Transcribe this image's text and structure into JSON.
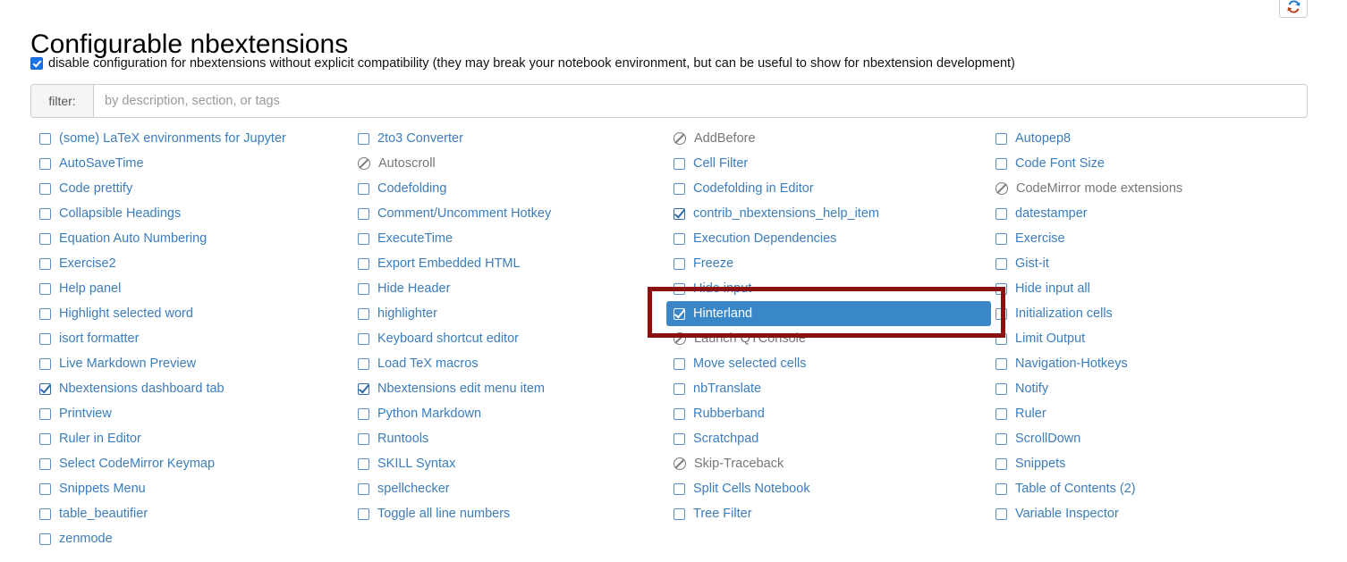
{
  "page": {
    "title": "Configurable nbextensions"
  },
  "refresh": {
    "icon": "refresh-icon",
    "tooltip": "refresh"
  },
  "disable_config": {
    "checked": true,
    "label": "disable configuration for nbextensions without explicit compatibility (they may break your notebook environment, but can be useful to show for nbextension development)"
  },
  "filter": {
    "addon_label": "filter:",
    "value": "",
    "placeholder": "by description, section, or tags"
  },
  "colors": {
    "link": "#3b7dbd",
    "selected_bg": "#3a87c8",
    "selected_fg": "#ffffff",
    "disabled_fg": "#777777",
    "annotation": "#8b1010",
    "checkbox_accent": "#1a73e8"
  },
  "annotation": {
    "shape": "rectangle",
    "color": "#8b1010",
    "target": "Hinterland"
  },
  "extensions": {
    "columns": [
      {
        "index": 0,
        "items": [
          {
            "label": "(some) LaTeX environments for Jupyter",
            "state": "unchecked"
          },
          {
            "label": "AutoSaveTime",
            "state": "unchecked"
          },
          {
            "label": "Code prettify",
            "state": "unchecked"
          },
          {
            "label": "Collapsible Headings",
            "state": "unchecked"
          },
          {
            "label": "Equation Auto Numbering",
            "state": "unchecked"
          },
          {
            "label": "Exercise2",
            "state": "unchecked"
          },
          {
            "label": "Help panel",
            "state": "unchecked"
          },
          {
            "label": "Highlight selected word",
            "state": "unchecked"
          },
          {
            "label": "isort formatter",
            "state": "unchecked"
          },
          {
            "label": "Live Markdown Preview",
            "state": "unchecked"
          },
          {
            "label": "Nbextensions dashboard tab",
            "state": "checked"
          },
          {
            "label": "Printview",
            "state": "unchecked"
          },
          {
            "label": "Ruler in Editor",
            "state": "unchecked"
          },
          {
            "label": "Select CodeMirror Keymap",
            "state": "unchecked"
          },
          {
            "label": "Snippets Menu",
            "state": "unchecked"
          },
          {
            "label": "table_beautifier",
            "state": "unchecked"
          },
          {
            "label": "zenmode",
            "state": "unchecked"
          }
        ]
      },
      {
        "index": 1,
        "items": [
          {
            "label": "2to3 Converter",
            "state": "unchecked"
          },
          {
            "label": "Autoscroll",
            "state": "disabled"
          },
          {
            "label": "Codefolding",
            "state": "unchecked"
          },
          {
            "label": "Comment/Uncomment Hotkey",
            "state": "unchecked"
          },
          {
            "label": "ExecuteTime",
            "state": "unchecked"
          },
          {
            "label": "Export Embedded HTML",
            "state": "unchecked"
          },
          {
            "label": "Hide Header",
            "state": "unchecked"
          },
          {
            "label": "highlighter",
            "state": "unchecked"
          },
          {
            "label": "Keyboard shortcut editor",
            "state": "unchecked"
          },
          {
            "label": "Load TeX macros",
            "state": "unchecked"
          },
          {
            "label": "Nbextensions edit menu item",
            "state": "checked"
          },
          {
            "label": "Python Markdown",
            "state": "unchecked"
          },
          {
            "label": "Runtools",
            "state": "unchecked"
          },
          {
            "label": "SKILL Syntax",
            "state": "unchecked"
          },
          {
            "label": "spellchecker",
            "state": "unchecked"
          },
          {
            "label": "Toggle all line numbers",
            "state": "unchecked"
          }
        ]
      },
      {
        "index": 2,
        "items": [
          {
            "label": "AddBefore",
            "state": "disabled"
          },
          {
            "label": "Cell Filter",
            "state": "unchecked"
          },
          {
            "label": "Codefolding in Editor",
            "state": "unchecked"
          },
          {
            "label": "contrib_nbextensions_help_item",
            "state": "checked"
          },
          {
            "label": "Execution Dependencies",
            "state": "unchecked"
          },
          {
            "label": "Freeze",
            "state": "unchecked"
          },
          {
            "label": "Hide input",
            "state": "unchecked"
          },
          {
            "label": "Hinterland",
            "state": "checked",
            "selected": true
          },
          {
            "label": "Launch QTConsole",
            "state": "disabled"
          },
          {
            "label": "Move selected cells",
            "state": "unchecked"
          },
          {
            "label": "nbTranslate",
            "state": "unchecked"
          },
          {
            "label": "Rubberband",
            "state": "unchecked"
          },
          {
            "label": "Scratchpad",
            "state": "unchecked"
          },
          {
            "label": "Skip-Traceback",
            "state": "disabled"
          },
          {
            "label": "Split Cells Notebook",
            "state": "unchecked"
          },
          {
            "label": "Tree Filter",
            "state": "unchecked"
          }
        ]
      },
      {
        "index": 3,
        "items": [
          {
            "label": "Autopep8",
            "state": "unchecked"
          },
          {
            "label": "Code Font Size",
            "state": "unchecked"
          },
          {
            "label": "CodeMirror mode extensions",
            "state": "disabled"
          },
          {
            "label": "datestamper",
            "state": "unchecked"
          },
          {
            "label": "Exercise",
            "state": "unchecked"
          },
          {
            "label": "Gist-it",
            "state": "unchecked"
          },
          {
            "label": "Hide input all",
            "state": "unchecked"
          },
          {
            "label": "Initialization cells",
            "state": "unchecked"
          },
          {
            "label": "Limit Output",
            "state": "unchecked"
          },
          {
            "label": "Navigation-Hotkeys",
            "state": "unchecked"
          },
          {
            "label": "Notify",
            "state": "unchecked"
          },
          {
            "label": "Ruler",
            "state": "unchecked"
          },
          {
            "label": "ScrollDown",
            "state": "unchecked"
          },
          {
            "label": "Snippets",
            "state": "unchecked"
          },
          {
            "label": "Table of Contents (2)",
            "state": "unchecked"
          },
          {
            "label": "Variable Inspector",
            "state": "unchecked"
          }
        ]
      }
    ]
  }
}
